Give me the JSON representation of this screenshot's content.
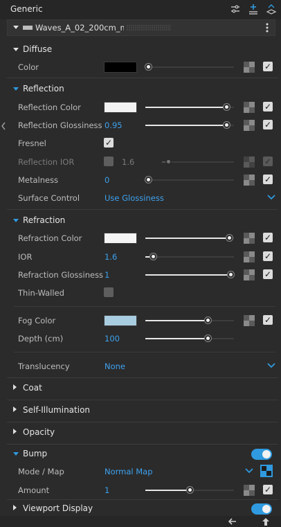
{
  "header": {
    "title": "Generic"
  },
  "material": {
    "name": "Waves_A_02_200cm_m"
  },
  "diffuse": {
    "title": "Diffuse",
    "color_label": "Color",
    "color": "#000000",
    "color_mult": 0
  },
  "reflection": {
    "title": "Reflection",
    "color_label": "Reflection Color",
    "color": "#f2f2f2",
    "color_mult": 0.95,
    "gloss_label": "Reflection Glossiness",
    "gloss_value": "0.95",
    "gloss_fraction": 0.95,
    "fresnel_label": "Fresnel",
    "ior_label": "Reflection IOR",
    "ior_value": "1.6",
    "ior_fraction": 0.05,
    "metalness_label": "Metalness",
    "metalness_value": "0",
    "metalness_fraction": 0,
    "surface_label": "Surface Control",
    "surface_value": "Use Glossiness"
  },
  "refraction": {
    "title": "Refraction",
    "color_label": "Refraction Color",
    "color": "#f5f5f5",
    "color_mult": 0.98,
    "ior_label": "IOR",
    "ior_value": "1.6",
    "ior_fraction": 0.06,
    "gloss_label": "Refraction Glossiness",
    "gloss_value": "1",
    "gloss_fraction": 1,
    "thin_label": "Thin-Walled",
    "fog_label": "Fog Color",
    "fog_color": "#a9cde0",
    "fog_mult": 0.72,
    "depth_label": "Depth (cm)",
    "depth_value": "100",
    "depth_fraction": 0.72,
    "translucency_label": "Translucency",
    "translucency_value": "None"
  },
  "collapsed": {
    "coat": "Coat",
    "self_illum": "Self-Illumination",
    "opacity": "Opacity"
  },
  "bump": {
    "title": "Bump",
    "mode_label": "Mode / Map",
    "mode_value": "Normal Map",
    "amount_label": "Amount",
    "amount_value": "1",
    "amount_fraction": 0.5
  },
  "viewport": {
    "title": "Viewport Display"
  },
  "colors": {
    "accent": "#2f9ae0",
    "bg": "#2b2b2b"
  }
}
